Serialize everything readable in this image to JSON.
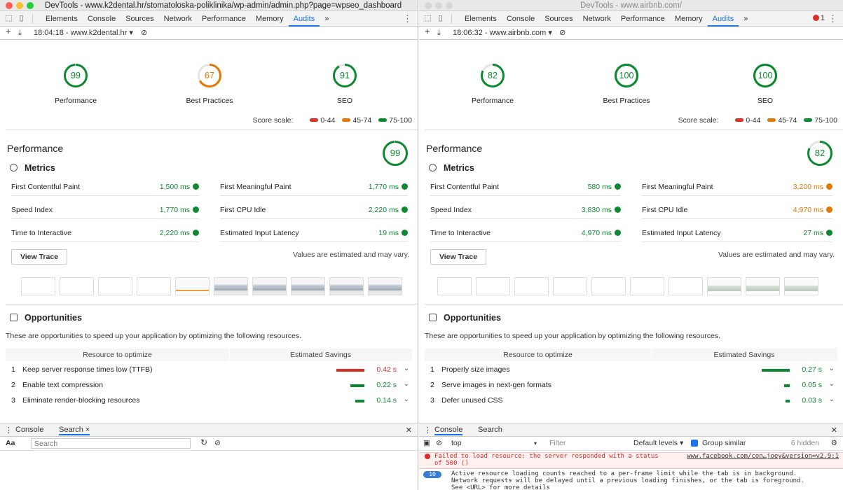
{
  "windows": [
    {
      "title": "DevTools - www.k2dental.hr/stomatoloska-poliklinika/wp-admin/admin.php?page=wpseo_dashboard",
      "tabs": [
        "Elements",
        "Console",
        "Sources",
        "Network",
        "Performance",
        "Memory",
        "Audits",
        "»"
      ],
      "active_tab": "Audits",
      "error_count": "",
      "report_select": "18:04:18 - www.k2dental.hr ▾",
      "gauges": [
        {
          "label": "Performance",
          "score": "99",
          "value": 99,
          "color": "#0c8a30"
        },
        {
          "label": "Best Practices",
          "score": "67",
          "value": 67,
          "color": "#e67700"
        },
        {
          "label": "SEO",
          "score": "91",
          "value": 91,
          "color": "#0c8a30"
        }
      ],
      "score_scale": {
        "label": "Score scale:",
        "ranges": [
          "0-44",
          "45-74",
          "75-100"
        ]
      },
      "section_title": "Performance",
      "section_score": {
        "score": "99",
        "value": 99,
        "color": "#0c8a30"
      },
      "metrics_title": "Metrics",
      "metrics": [
        {
          "name": "First Contentful Paint",
          "value": "1,500 ms",
          "status": "pass"
        },
        {
          "name": "First Meaningful Paint",
          "value": "1,770 ms",
          "status": "pass"
        },
        {
          "name": "Speed Index",
          "value": "1,770 ms",
          "status": "pass"
        },
        {
          "name": "First CPU Idle",
          "value": "2,220 ms",
          "status": "pass"
        },
        {
          "name": "Time to Interactive",
          "value": "2,220 ms",
          "status": "pass"
        },
        {
          "name": "Estimated Input Latency",
          "value": "19 ms",
          "status": "pass"
        }
      ],
      "view_trace": "View Trace",
      "values_note": "Values are estimated and may vary.",
      "filmstrip": [
        "blank",
        "blank",
        "blank",
        "blank",
        "part",
        "shot",
        "shot",
        "shot",
        "shot",
        "shot"
      ],
      "opportunities_title": "Opportunities",
      "opportunities_desc": "These are opportunities to speed up your application by optimizing the following resources.",
      "opp_headers": [
        "Resource to optimize",
        "Estimated Savings"
      ],
      "opportunities": [
        {
          "num": "1",
          "label": "Keep server response times low (TTFB)",
          "value": "0.42 s",
          "fraction": 1.0,
          "color": "#d93025"
        },
        {
          "num": "2",
          "label": "Enable text compression",
          "value": "0.22 s",
          "fraction": 0.5,
          "color": "#0c8a30"
        },
        {
          "num": "3",
          "label": "Eliminate render-blocking resources",
          "value": "0.14 s",
          "fraction": 0.33,
          "color": "#0c8a30"
        }
      ],
      "drawer_tabs": [
        "Console",
        "Search ×"
      ],
      "drawer_active": "Search ×",
      "drawer_search": {
        "aa": "Aa",
        ".*": ".*",
        "placeholder": "Search"
      },
      "console_context": "",
      "console_filter": "",
      "console_levels": "",
      "console_group": "",
      "console_hidden": "",
      "console_messages": []
    },
    {
      "title": "DevTools - www.airbnb.com/",
      "tabs": [
        "Elements",
        "Console",
        "Sources",
        "Network",
        "Performance",
        "Memory",
        "Audits",
        "»"
      ],
      "active_tab": "Audits",
      "error_count": "1",
      "report_select": "18:06:32 - www.airbnb.com ▾",
      "gauges": [
        {
          "label": "Performance",
          "score": "82",
          "value": 82,
          "color": "#0c8a30"
        },
        {
          "label": "Best Practices",
          "score": "100",
          "value": 100,
          "color": "#0c8a30"
        },
        {
          "label": "SEO",
          "score": "100",
          "value": 100,
          "color": "#0c8a30"
        }
      ],
      "score_scale": {
        "label": "Score scale:",
        "ranges": [
          "0-44",
          "45-74",
          "75-100"
        ]
      },
      "section_title": "Performance",
      "section_score": {
        "score": "82",
        "value": 82,
        "color": "#0c8a30"
      },
      "metrics_title": "Metrics",
      "metrics": [
        {
          "name": "First Contentful Paint",
          "value": "580 ms",
          "status": "pass"
        },
        {
          "name": "First Meaningful Paint",
          "value": "3,200 ms",
          "status": "average"
        },
        {
          "name": "Speed Index",
          "value": "3,830 ms",
          "status": "pass"
        },
        {
          "name": "First CPU Idle",
          "value": "4,970 ms",
          "status": "average"
        },
        {
          "name": "Time to Interactive",
          "value": "4,970 ms",
          "status": "pass"
        },
        {
          "name": "Estimated Input Latency",
          "value": "27 ms",
          "status": "pass"
        }
      ],
      "view_trace": "View Trace",
      "values_note": "Values are estimated and may vary.",
      "filmstrip": [
        "blank",
        "blank",
        "blank",
        "blank",
        "blank",
        "blank",
        "blank",
        "shot2",
        "shot2",
        "shot2"
      ],
      "opportunities_title": "Opportunities",
      "opportunities_desc": "These are opportunities to speed up your application by optimizing the following resources.",
      "opp_headers": [
        "Resource to optimize",
        "Estimated Savings"
      ],
      "opportunities": [
        {
          "num": "1",
          "label": "Properly size images",
          "value": "0.27 s",
          "fraction": 1.0,
          "color": "#0c8a30"
        },
        {
          "num": "2",
          "label": "Serve images in next-gen formats",
          "value": "0.05 s",
          "fraction": 0.2,
          "color": "#0c8a30"
        },
        {
          "num": "3",
          "label": "Defer unused CSS",
          "value": "0.03 s",
          "fraction": 0.1,
          "color": "#0c8a30"
        }
      ],
      "drawer_tabs": [
        "Console",
        "Search"
      ],
      "drawer_active": "Console",
      "drawer_search": null,
      "console_context": "top",
      "console_filter": "Filter",
      "console_levels": "Default levels ▾",
      "console_group": "Group similar",
      "console_hidden": "6 hidden",
      "console_messages": [
        {
          "type": "error",
          "text": "Failed to load resource: the server responded with a status\nof 500 ()",
          "url": "www.facebook.com/con…joey&version=v2.9:1",
          "badge": ""
        },
        {
          "type": "info",
          "text": "Active resource loading counts reached to a per-frame limit while the tab is in background.\nNetwork requests will be delayed until a previous loading finishes, or the tab is foreground.\nSee <URL> for more details",
          "url": "",
          "badge": "10"
        }
      ]
    }
  ],
  "colors": {
    "pass": "#0c8a30",
    "average": "#e67700",
    "fail": "#d93025",
    "accent": "#1a73e8"
  }
}
